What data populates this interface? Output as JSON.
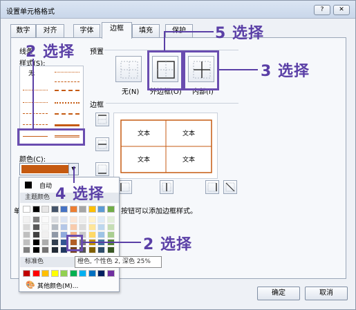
{
  "window": {
    "title": "设置单元格格式",
    "help_glyph": "?",
    "close_glyph": "✕"
  },
  "tabs": [
    {
      "label": "数字"
    },
    {
      "label": "对齐"
    },
    {
      "label": "字体"
    },
    {
      "label": "边框",
      "active": true
    },
    {
      "label": "填充"
    },
    {
      "label": "保护"
    }
  ],
  "line": {
    "group_label": "线条",
    "style_label": "样式(S):",
    "none_label": "无",
    "color_label": "颜色(C):",
    "selected_color": "#c55a11"
  },
  "presets": {
    "group_label": "预置",
    "none": "无(N)",
    "outline": "外边框(O)",
    "inside": "内部(I)"
  },
  "border": {
    "group_label": "边框",
    "cell_text": "文本",
    "hint_suffix": "按钮可以添加边框样式。",
    "hint_prefix": "单"
  },
  "color_popup": {
    "automatic": "自动",
    "theme_label": "主题颜色",
    "standard_label": "标准色",
    "more_colors": "其他颜色(M)...",
    "tooltip": "橙色, 个性色 2, 深色 25%",
    "theme_row": [
      "#ffffff",
      "#000000",
      "#e7e6e6",
      "#44546a",
      "#4472c4",
      "#ed7d31",
      "#a5a5a5",
      "#ffc000",
      "#5b9bd5",
      "#70ad47"
    ],
    "standard_row": [
      "#c00000",
      "#ff0000",
      "#ffc000",
      "#ffff00",
      "#92d050",
      "#00b050",
      "#00b0f0",
      "#0070c0",
      "#002060",
      "#7030a0"
    ]
  },
  "buttons": {
    "ok": "确定",
    "cancel": "取消"
  },
  "annotations": {
    "step5": "5 选择",
    "step3": "3 选择",
    "step2a": "2 选择",
    "step4": "4 选择",
    "step2b": "2 选择",
    "accent_color": "#5a3fa6"
  }
}
